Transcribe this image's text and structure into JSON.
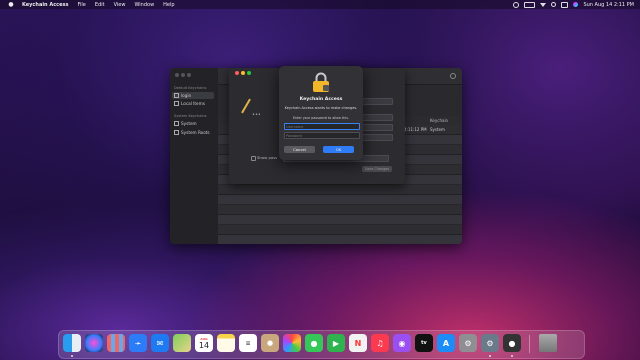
{
  "menubar": {
    "app_name": "Keychain Access",
    "menus": [
      "File",
      "Edit",
      "View",
      "Window",
      "Help"
    ],
    "datetime": "Sun Aug 14  2:11 PM"
  },
  "sidebar": {
    "default_group": "Default Keychains",
    "default_items": [
      "login",
      "Local Items"
    ],
    "system_group": "System Keychains",
    "system_items": [
      "System",
      "System Roots"
    ]
  },
  "list": {
    "kind_header": "Keychain",
    "row_date": "4:11:12 PM",
    "row_keychain": "System"
  },
  "info_panel": {
    "show_password_label": "Show password:",
    "save_button": "Save Changes"
  },
  "auth_dialog": {
    "title": "Keychain Access",
    "message": "Keychain Access wants to make changes.",
    "prompt": "Enter your password to allow this.",
    "username_placeholder": "Username",
    "password_placeholder": "Password",
    "cancel_label": "Cancel",
    "ok_label": "OK",
    "accent": "#2f7cf6"
  },
  "dock": {
    "calendar_month": "AUG",
    "calendar_day": "14",
    "apps": [
      "Finder",
      "Siri",
      "Launchpad",
      "Safari",
      "Mail",
      "Maps",
      "Calendar",
      "Notes",
      "Reminders",
      "Contacts",
      "Photos",
      "Messages",
      "FaceTime",
      "News",
      "Music",
      "Podcasts",
      "Apple TV",
      "App Store",
      "System Preferences",
      "Keychain Access",
      "Accessibility",
      "Trash"
    ]
  }
}
